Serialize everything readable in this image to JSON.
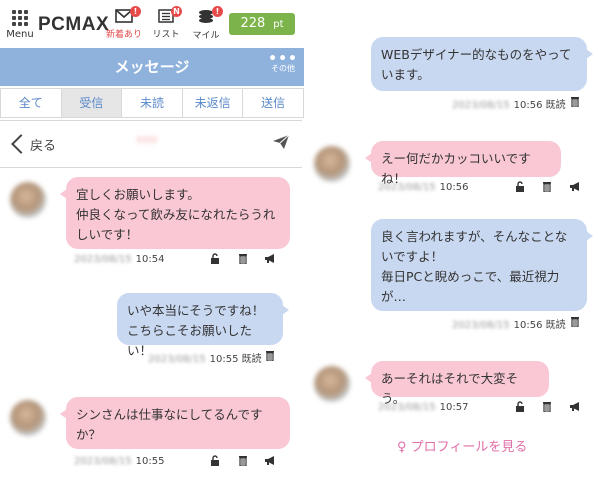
{
  "header": {
    "menu_label": "Menu",
    "logo_pc": "PC",
    "logo_max": "MAX",
    "icons": [
      {
        "name": "mail-icon",
        "label": "新着あり",
        "badge": "!"
      },
      {
        "name": "list-icon",
        "label": "リスト",
        "badge": "N"
      },
      {
        "name": "coins-icon",
        "label": "マイル",
        "badge": "!"
      }
    ],
    "points_value": "228",
    "points_unit": "pt"
  },
  "titlebar": {
    "title": "メッセージ",
    "more_icon": "•••",
    "more_label": "その他"
  },
  "tabs": [
    "全て",
    "受信",
    "未読",
    "未返信",
    "送信"
  ],
  "backbar": {
    "back_label": "戻る",
    "name_blurred": "????"
  },
  "messages": [
    {
      "side": "in",
      "text": "宜しくお願いします。\n仲良くなって飲み友になれたらうれしいです！",
      "date": "2023/08/15",
      "time": "10:54"
    },
    {
      "side": "out",
      "text": "いや本当にそうですね！\nこちらこそお願いしたい！",
      "date": "2023/08/15",
      "time": "10:55",
      "status": "既読"
    },
    {
      "side": "in",
      "text": "シンさんは仕事なにしてるんですか？",
      "date": "2023/08/15",
      "time": "10:55"
    },
    {
      "side": "out",
      "text": "WEBデザイナー的なものをやっています。",
      "date": "2023/08/15",
      "time": "10:56",
      "status": "既読"
    },
    {
      "side": "in",
      "text": "えー何だかカッコいいですね！",
      "date": "2023/08/15",
      "time": "10:56"
    },
    {
      "side": "out",
      "text": "良く言われますが、そんなことないですよ！\n毎日PCと睨めっこで、最近視力が…",
      "date": "2023/08/15",
      "time": "10:56",
      "status": "既読"
    },
    {
      "side": "in",
      "text": "あーそれはそれで大変そう。",
      "date": "2023/08/15",
      "time": "10:57"
    }
  ],
  "profile_link": "プロフィールを見る",
  "colors": {
    "titlebar": "#8fb2dd",
    "incoming_bubble": "#f9c8d4",
    "outgoing_bubble": "#c9d8f1",
    "points_badge": "#7cb44b",
    "tab_text": "#5a89c8",
    "profile_link": "#e26fa8"
  }
}
